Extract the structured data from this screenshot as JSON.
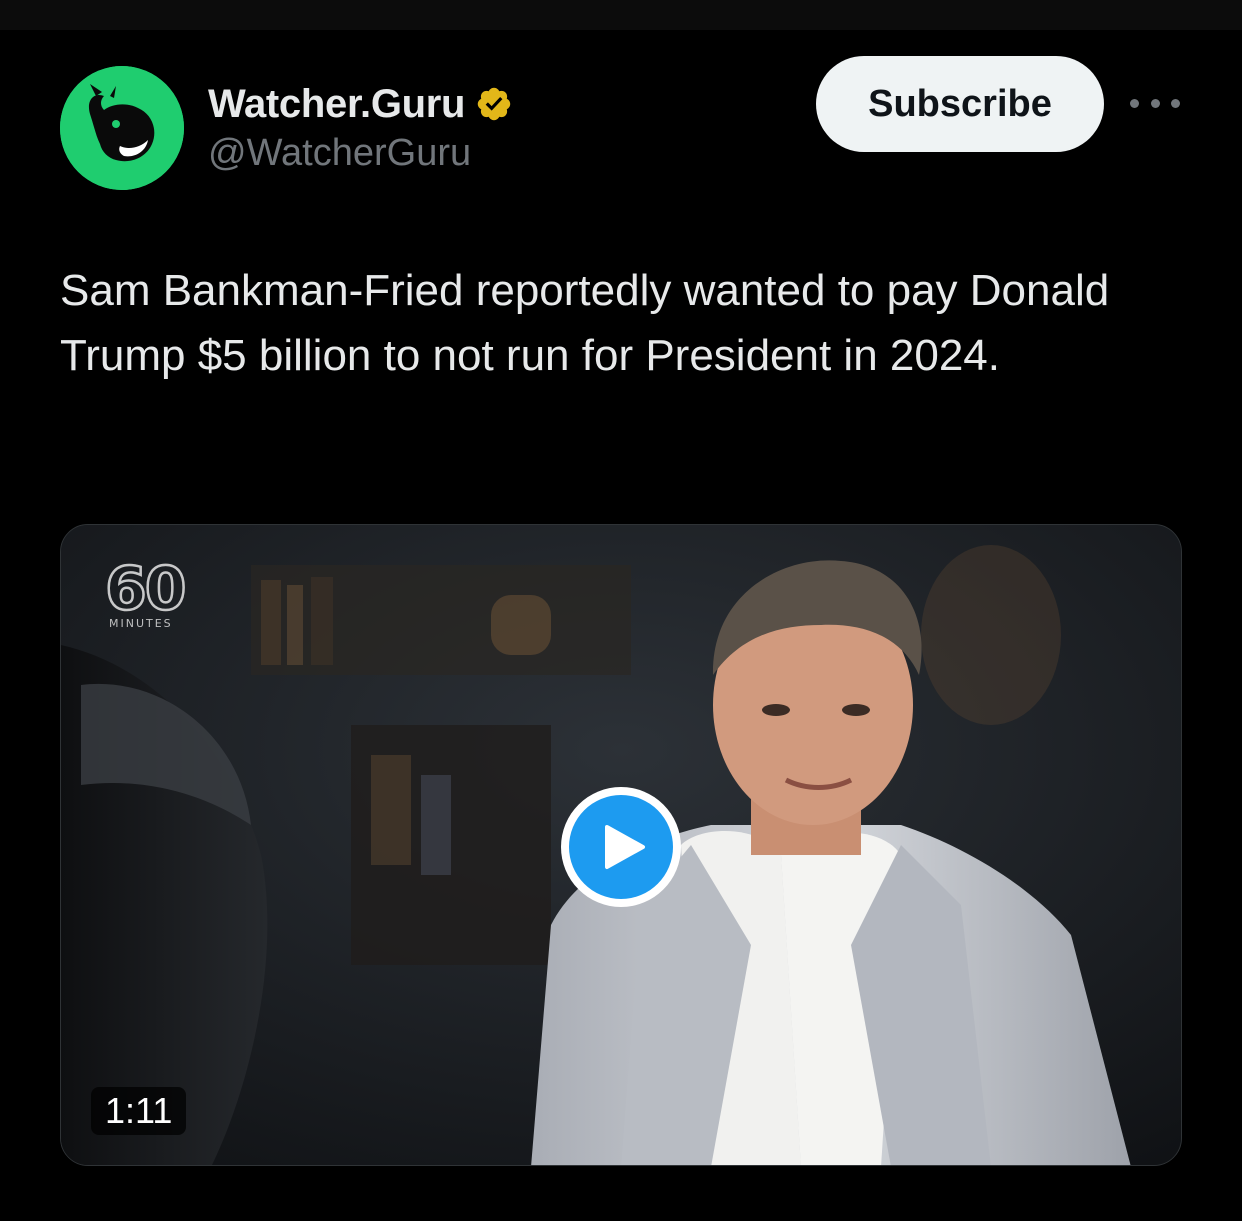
{
  "author": {
    "display_name": "Watcher.Guru",
    "handle": "@WatcherGuru",
    "verified": true,
    "avatar_icon": "whale-logo-icon",
    "avatar_color": "#1fcd6f"
  },
  "actions": {
    "subscribe_label": "Subscribe",
    "more_icon": "more-horizontal-icon"
  },
  "tweet": {
    "text": "Sam Bankman-Fried reportedly wanted to pay Donald Trump $5 billion to not run for President in 2024."
  },
  "media": {
    "type": "video",
    "duration": "1:11",
    "overlay_logo_number": "60",
    "overlay_logo_word": "MINUTES",
    "play_icon": "play-icon",
    "play_color": "#1d9bf0"
  },
  "colors": {
    "background": "#000000",
    "text_primary": "#e7e9ea",
    "text_secondary": "#71767b",
    "verified_badge": "#e2b719"
  }
}
